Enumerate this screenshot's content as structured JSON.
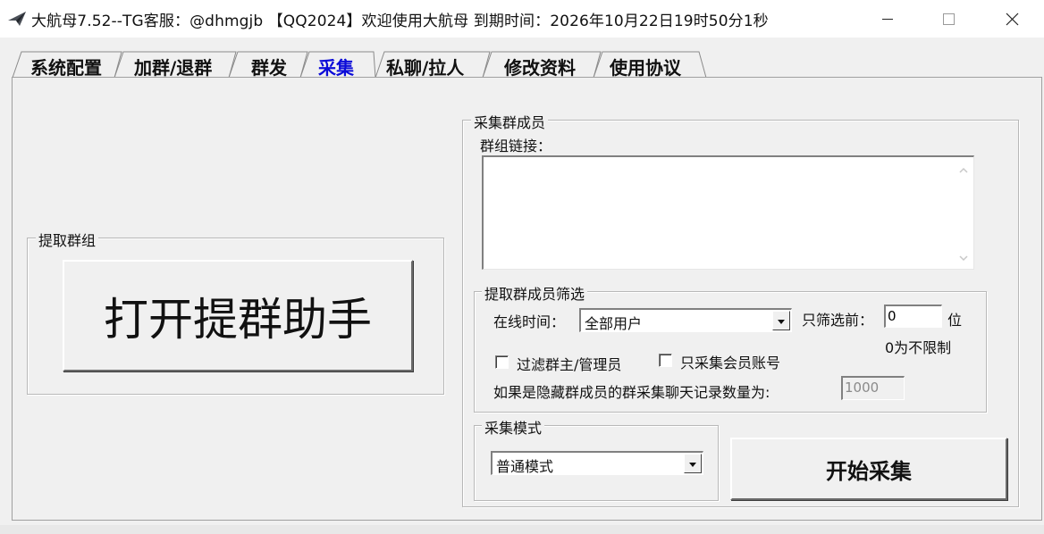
{
  "window": {
    "title": "大航母7.52--TG客服：@dhmgjb 【QQ2024】欢迎使用大航母 到期时间：2026年10月22日19时50分1秒",
    "icons": [
      "app-icon",
      "minimize-icon",
      "maximize-icon",
      "close-icon"
    ]
  },
  "tabs": [
    {
      "label": "系统配置",
      "active": false
    },
    {
      "label": "加群/退群",
      "active": false
    },
    {
      "label": "群发",
      "active": false
    },
    {
      "label": "采集",
      "active": true
    },
    {
      "label": "私聊/拉人",
      "active": false
    },
    {
      "label": "修改资料",
      "active": false
    },
    {
      "label": "使用协议",
      "active": false
    }
  ],
  "extract_group": {
    "legend": "提取群组",
    "open_button": "打开提群助手"
  },
  "collect_members": {
    "legend": "采集群成员",
    "link_label": "群组链接：",
    "link_value": ""
  },
  "filter": {
    "legend": "提取群成员筛选",
    "online_label": "在线时间：",
    "online_value": "全部用户",
    "top_label": "只筛选前：",
    "top_value": "0",
    "top_unit": "位",
    "top_hint": "0为不限制",
    "filter_admin_label": "过滤群主/管理员",
    "filter_admin_checked": false,
    "vip_only_label": "只采集会员账号",
    "vip_only_checked": false,
    "hidden_label": "如果是隐藏群成员的群采集聊天记录数量为:",
    "hidden_value": "1000"
  },
  "mode": {
    "legend": "采集模式",
    "value": "普通模式"
  },
  "start_button": "开始采集",
  "colors": {
    "active_tab": "#0b0bd8",
    "window_bg": "#f0f0f0"
  }
}
